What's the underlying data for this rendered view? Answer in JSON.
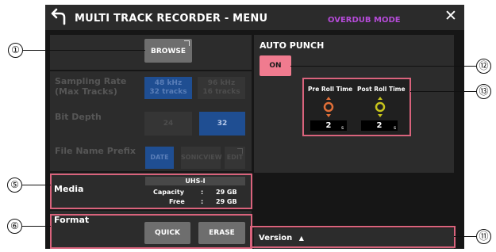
{
  "titlebar": {
    "title": "MULTI TRACK RECORDER - MENU",
    "mode": "OVERDUB MODE"
  },
  "left": {
    "browse_label": "BROWSE",
    "sampling_rate": {
      "label_line1": "Sampling Rate",
      "label_line2": "(Max Tracks)",
      "options": [
        {
          "line1": "48 kHz",
          "line2": "32 tracks",
          "selected": true
        },
        {
          "line1": "96 kHz",
          "line2": "16 tracks",
          "selected": false
        }
      ]
    },
    "bit_depth": {
      "label": "Bit Depth",
      "options": [
        "24",
        "32"
      ],
      "selected": "32"
    },
    "file_name_prefix": {
      "label": "File Name Prefix",
      "options": [
        "DATE",
        "SONICVIEW",
        "EDIT"
      ],
      "selected": "DATE"
    },
    "media": {
      "label": "Media",
      "type": "UHS-I",
      "capacity_label": "Capacity",
      "capacity_value": "29 GB",
      "free_label": "Free",
      "free_value": "29 GB",
      "separator": ":"
    },
    "format": {
      "label": "Format",
      "quick_label": "QUICK",
      "erase_label": "ERASE"
    }
  },
  "right": {
    "auto_punch": {
      "label": "AUTO PUNCH",
      "on_label": "ON"
    },
    "pre_roll": {
      "label": "Pre Roll Time",
      "value": "2",
      "unit": "s",
      "knob_color": "#e06f38"
    },
    "post_roll": {
      "label": "Post Roll Time",
      "value": "2",
      "unit": "s",
      "knob_color": "#c7c41c"
    },
    "version": {
      "label": "Version",
      "arrow": "▲"
    }
  },
  "callouts": {
    "c1": "①",
    "c5": "⑤",
    "c6": "⑥",
    "c11": "⑪",
    "c12": "⑫",
    "c13": "⑬"
  },
  "colors": {
    "accent": "#d9637c",
    "selected": "#1f4e92",
    "on_button": "#f07b8f",
    "mode": "#b54bd8"
  },
  "icons": [
    "back-arrow-icon",
    "close-icon",
    "external-link-icon",
    "knob-icon",
    "triangle-up-icon"
  ]
}
